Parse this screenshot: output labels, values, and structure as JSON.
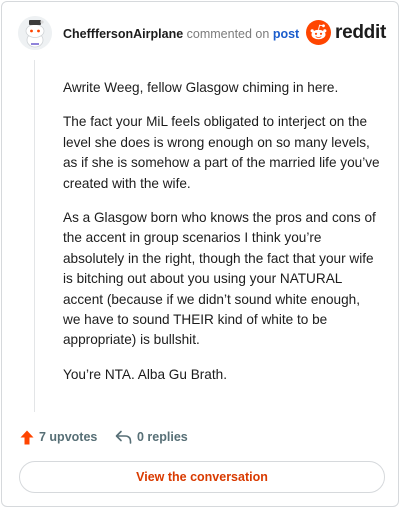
{
  "header": {
    "author": "ChefffersonAirplane",
    "commented_text": "commented on",
    "post_link": "post",
    "brand": "reddit"
  },
  "comment": {
    "paragraphs": [
      "Awrite Weeg, fellow Glasgow chiming in here.",
      "The fact your MiL feels obligated to interject on the level she does is wrong enough on so many levels, as if she is somehow a part of the married life you’ve created with the wife.",
      "As a Glasgow born who knows the pros and cons of the accent in group scenarios I think you’re absolutely in the right, though the fact that your wife is bitching out about you using your NATURAL accent (because if we didn’t sound white enough, we have to sound THEIR kind of white to be appropriate) is bullshit.",
      "You’re NTA. Alba Gu Brath."
    ]
  },
  "actions": {
    "upvotes": "7 upvotes",
    "replies": "0 replies"
  },
  "cta": {
    "label": "View the conversation"
  },
  "colors": {
    "upvote": "#ff4500",
    "cta_text": "#d93a00",
    "link": "#1a5ccc"
  }
}
